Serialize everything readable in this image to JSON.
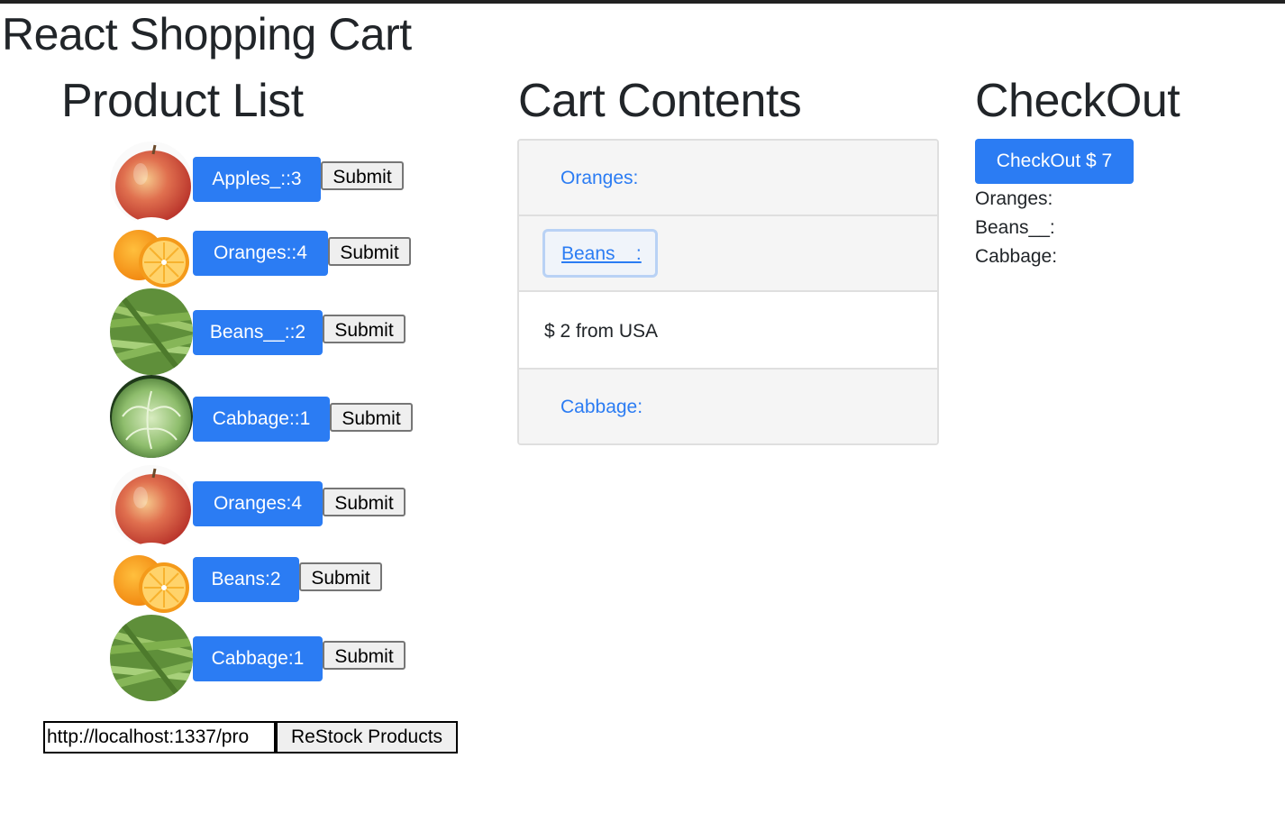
{
  "app": {
    "title": "React Shopping Cart"
  },
  "columns": {
    "products": "Product List",
    "cart": "Cart Contents",
    "checkout": "CheckOut"
  },
  "products": [
    {
      "label": "Apples_::3",
      "image": "apple"
    },
    {
      "label": "Oranges::4",
      "image": "orange"
    },
    {
      "label": "Beans__::2",
      "image": "beans"
    },
    {
      "label": "Cabbage::1",
      "image": "cabbage"
    },
    {
      "label": "Oranges:4",
      "image": "apple"
    },
    {
      "label": "Beans:2",
      "image": "orange"
    },
    {
      "label": "Cabbage:1",
      "image": "beans"
    }
  ],
  "submit_label": "Submit",
  "cart": {
    "items": [
      "Oranges:",
      "Beans__:",
      "$ 2 from USA",
      "Cabbage:"
    ]
  },
  "checkout": {
    "button_label": "CheckOut $ 7",
    "items": [
      "Oranges:",
      "Beans__:",
      "Cabbage:"
    ]
  },
  "restock": {
    "url_value": "http://localhost:1337/pro",
    "button_label": "ReStock Products"
  },
  "colors": {
    "primary": "#2b7cf3",
    "text": "#212529",
    "focus": "#b9d2f5"
  }
}
